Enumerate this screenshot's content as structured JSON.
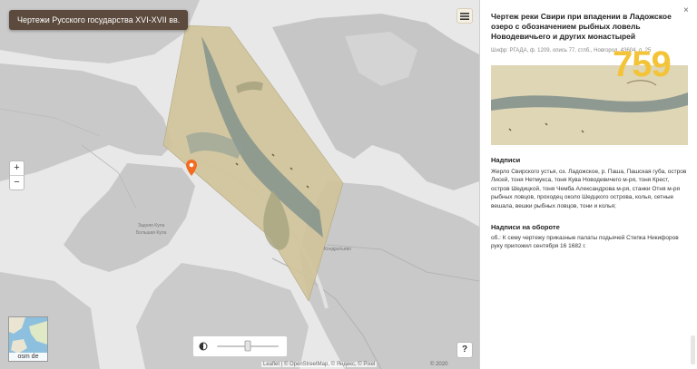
{
  "app": {
    "title_button": "Чертежи Русского государства XVI-XVII вв."
  },
  "map": {
    "zoom_in": "+",
    "zoom_out": "−",
    "minimap_label": "osm de",
    "help": "?",
    "attribution": "Leaflet | © OpenStreetMap, © Яндекс, © Pixel",
    "scale": "© 2020",
    "labels": [
      "Кондратьево",
      "Задняя Кула",
      "Большая Кула"
    ]
  },
  "panel": {
    "close": "×",
    "title": "Чертеж реки Свири при впадении в Ладожское озеро с обозначением рыбных ловель Новодевичьего и других монастырей",
    "cipher": "Шифр: РГАДА, ф. 1209, опись 77, стлб., Новгород, 43604, л. 25",
    "number": "759",
    "inscriptions_heading": "Надписи",
    "inscriptions_text": "Жерло Свирского устья, оз. Ладожское, р. Паша, Пашская губа, остров Лисей, тоня Нетмукса, тоня Кува Новодевичего м-ря, тоня Крест, остров Шедицкой, тоня Чемба Александрова м-ря, станки Отня м-ря рыбных ловцов, проходец около Шедцкого острова, колья, сетные вешала, вешки рыбных ловцов, тони и колья;",
    "reverse_heading": "Надписи на обороте",
    "reverse_text": "об.: К сему чертежу приказные палаты подьячей Степка Никифоров руку приложил сентября 16 1682 г."
  },
  "colors": {
    "title_button_bg": "#5b4a3d",
    "number": "#f3c338",
    "pin": "#f26b21",
    "water": "#e7e7e7",
    "land": "#c9c9c9",
    "overlay": "#cfc39a"
  }
}
